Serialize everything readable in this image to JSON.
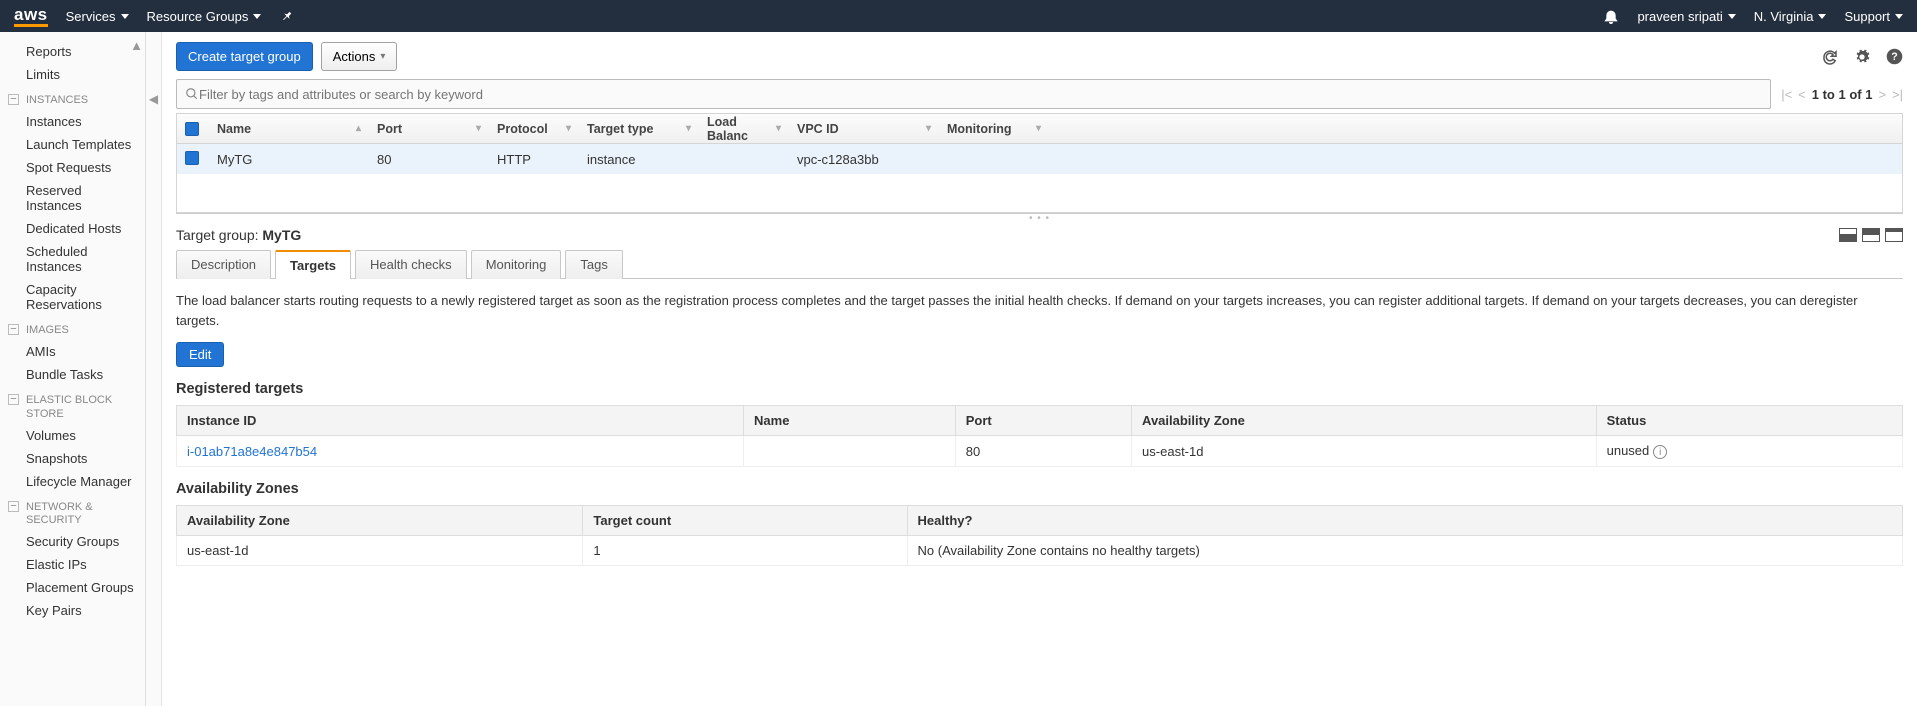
{
  "topnav": {
    "services": "Services",
    "resource_groups": "Resource Groups",
    "user": "praveen sripati",
    "region": "N. Virginia",
    "support": "Support"
  },
  "sidebar": {
    "top_items": [
      "Reports",
      "Limits"
    ],
    "groups": [
      {
        "title": "INSTANCES",
        "items": [
          "Instances",
          "Launch Templates",
          "Spot Requests",
          "Reserved Instances",
          "Dedicated Hosts",
          "Scheduled Instances",
          "Capacity Reservations"
        ]
      },
      {
        "title": "IMAGES",
        "items": [
          "AMIs",
          "Bundle Tasks"
        ]
      },
      {
        "title": "ELASTIC BLOCK STORE",
        "items": [
          "Volumes",
          "Snapshots",
          "Lifecycle Manager"
        ]
      },
      {
        "title": "NETWORK & SECURITY",
        "items": [
          "Security Groups",
          "Elastic IPs",
          "Placement Groups",
          "Key Pairs"
        ]
      }
    ]
  },
  "toolbar": {
    "create_label": "Create target group",
    "actions_label": "Actions"
  },
  "filter": {
    "placeholder": "Filter by tags and attributes or search by keyword"
  },
  "pager": {
    "range": "1 to 1 of 1"
  },
  "grid": {
    "columns": [
      "Name",
      "Port",
      "Protocol",
      "Target type",
      "Load Balanc",
      "VPC ID",
      "Monitoring"
    ],
    "row": {
      "name": "MyTG",
      "port": "80",
      "protocol": "HTTP",
      "target_type": "instance",
      "load_balancer": "",
      "vpc_id": "vpc-c128a3bb",
      "monitoring": ""
    }
  },
  "details": {
    "title_prefix": "Target group: ",
    "title_value": "MyTG",
    "tabs": [
      "Description",
      "Targets",
      "Health checks",
      "Monitoring",
      "Tags"
    ],
    "active_tab_index": 1,
    "body_text": "The load balancer starts routing requests to a newly registered target as soon as the registration process completes and the target passes the initial health checks. If demand on your targets increases, you can register additional targets. If demand on your targets decreases, you can deregister targets.",
    "edit_label": "Edit",
    "registered_title": "Registered targets",
    "registered_cols": [
      "Instance ID",
      "Name",
      "Port",
      "Availability Zone",
      "Status"
    ],
    "registered_row": {
      "instance_id": "i-01ab71a8e4e847b54",
      "name": "",
      "port": "80",
      "az": "us-east-1d",
      "status": "unused"
    },
    "az_title": "Availability Zones",
    "az_cols": [
      "Availability Zone",
      "Target count",
      "Healthy?"
    ],
    "az_row": {
      "az": "us-east-1d",
      "count": "1",
      "healthy": "No (Availability Zone contains no healthy targets)"
    }
  }
}
